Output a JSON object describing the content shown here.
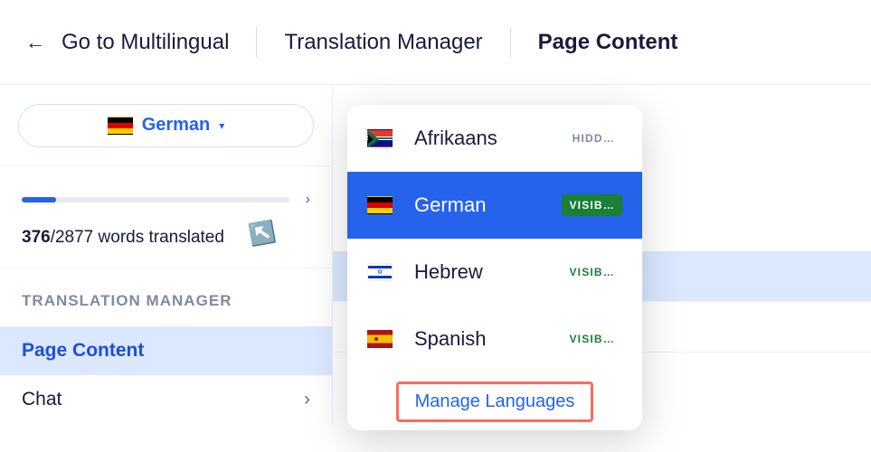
{
  "header": {
    "back_label": "Go to Multilingual",
    "crumb1": "Translation Manager",
    "crumb2": "Page Content"
  },
  "lang_selector": {
    "current": "German"
  },
  "progress": {
    "done": "376",
    "sep_total": "/2877",
    "suffix": " words translated",
    "percent": 13
  },
  "section_title": "TRANSLATION MANAGER",
  "nav": {
    "items": [
      {
        "label": "Page Content"
      },
      {
        "label": "Chat"
      }
    ]
  },
  "dropdown": {
    "items": [
      {
        "name": "Afrikaans",
        "status": "HIDD…",
        "kind": "hid"
      },
      {
        "name": "German",
        "status": "VISIB…",
        "kind": "vis-inv"
      },
      {
        "name": "Hebrew",
        "status": "VISIB…",
        "kind": "vis"
      },
      {
        "name": "Spanish",
        "status": "VISIB…",
        "kind": "vis"
      }
    ],
    "footer": "Manage Languages"
  }
}
